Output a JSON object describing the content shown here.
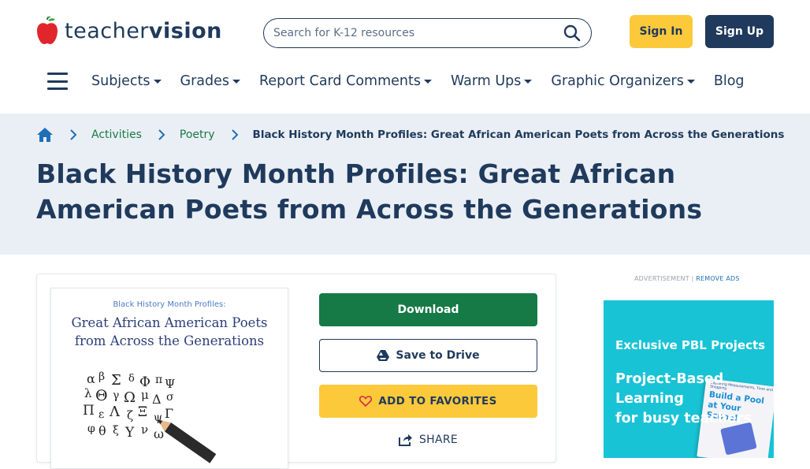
{
  "header": {
    "logo": {
      "part1": "teacher",
      "part2": "vision"
    },
    "search": {
      "placeholder": "Search for K-12 resources",
      "icon": "search-icon"
    },
    "signin_label": "Sign In",
    "signup_label": "Sign Up"
  },
  "nav": {
    "items": [
      {
        "label": "Subjects",
        "dropdown": true
      },
      {
        "label": "Grades",
        "dropdown": true
      },
      {
        "label": "Report Card Comments",
        "dropdown": true
      },
      {
        "label": "Warm Ups",
        "dropdown": true
      },
      {
        "label": "Graphic Organizers",
        "dropdown": true
      },
      {
        "label": "Blog",
        "dropdown": false
      }
    ]
  },
  "breadcrumb": {
    "items": [
      "Activities",
      "Poetry"
    ],
    "current": "Black History Month Profiles: Great African American Poets from Across the Generations"
  },
  "page": {
    "title": "Black History Month Profiles: Great African American Poets from Across the Generations"
  },
  "resource": {
    "thumb_subtitle": "Black History Month Profiles:",
    "thumb_title_line1": "Great African American Poets",
    "thumb_title_line2": "from Across the Generations",
    "download_label": "Download",
    "drive_label": "Save to Drive",
    "favorites_label": "ADD TO FAVORITES",
    "share_label": "SHARE"
  },
  "ad": {
    "label": "ADVERTISEMENT |",
    "remove_label": "REMOVE ADS",
    "headline": "Exclusive PBL Projects",
    "body_line1": "Project-Based",
    "body_line2": "Learning",
    "body_line3": "for busy teachers",
    "book_subtitle": "Exploring Measurements, Time and Shopping",
    "book_title": "Build a Pool at Your School"
  },
  "colors": {
    "navy": "#1f3a5c",
    "green": "#157a45",
    "yellow": "#fcc93b",
    "hero_bg": "#eaeff5",
    "ad_bg": "#18c3d6",
    "apple_red": "#e0262b"
  }
}
